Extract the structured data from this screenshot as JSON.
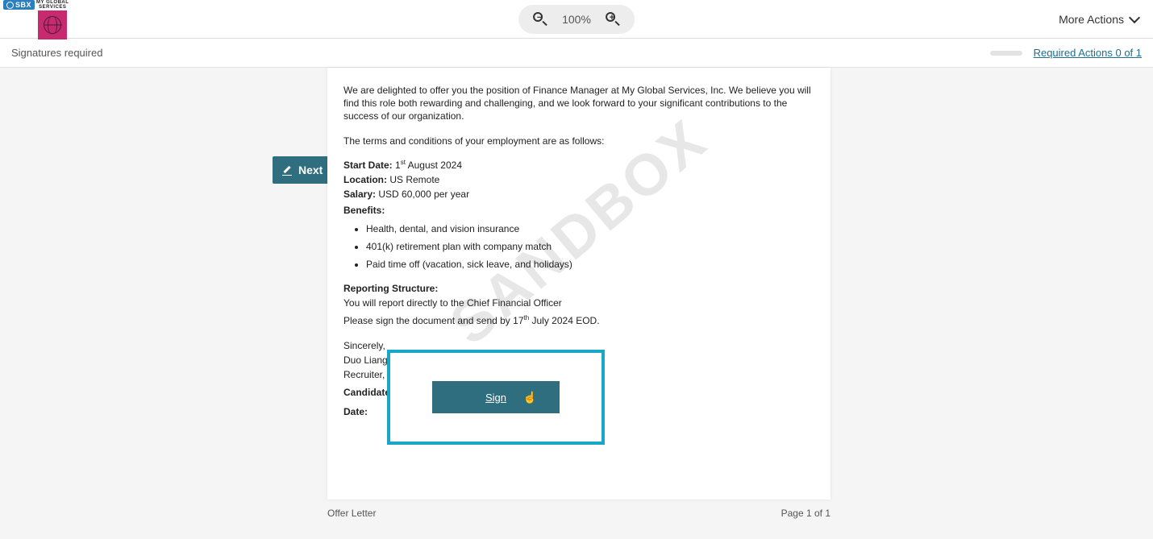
{
  "header": {
    "sbx_badge": "SBX",
    "logo_line1": "MY GLOBAL",
    "logo_line2": "SERVICES",
    "zoom_level": "100%",
    "more_actions": "More Actions"
  },
  "subheader": {
    "status": "Signatures required",
    "required_actions": "Required Actions 0 of 1"
  },
  "next_button": "Next",
  "watermark": "SANDBOX",
  "document": {
    "intro": "We are delighted to offer you the position of Finance Manager at My Global Services, Inc. We believe you will find this role both rewarding and challenging, and we look forward to your significant contributions to the success of our organization.",
    "terms_heading": "The terms and conditions of your employment are as follows:",
    "start_date_label": "Start Date:",
    "start_date_value_pre": " 1",
    "start_date_sup": "st",
    "start_date_value_post": " August 2024",
    "location_label": "Location:",
    "location_value": " US Remote",
    "salary_label": "Salary:",
    "salary_value": " USD 60,000 per year",
    "benefits_label": "Benefits:",
    "benefits": [
      "Health, dental, and vision insurance",
      "401(k) retirement plan with company match",
      "Paid time off (vacation, sick leave, and holidays)"
    ],
    "reporting_label": "Reporting Structure:",
    "reporting_value": "You will report directly to the Chief Financial Officer",
    "sign_request_pre": "Please sign the document and send by 17",
    "sign_request_sup": "th",
    "sign_request_post": " July 2024 EOD.",
    "sincerely": "Sincerely,",
    "sender_name": "Duo Liang",
    "sender_title": "Recruiter, My Global Services, Inc",
    "candidate_sig_label": "Candidate Signature:",
    "date_label": "Date:"
  },
  "sign_button": "Sign",
  "footer": {
    "doc_name": "Offer Letter",
    "page_indicator": "Page 1 of 1"
  }
}
